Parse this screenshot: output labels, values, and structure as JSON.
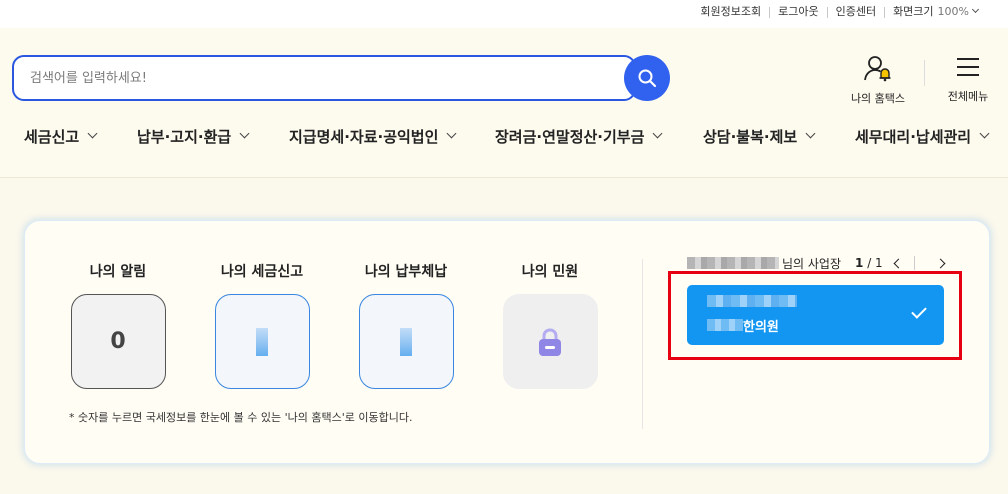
{
  "util_bar": {
    "items": [
      "회원정보조회",
      "로그아웃",
      "인증센터"
    ],
    "zoom_label": "화면크기",
    "zoom_value": "100%"
  },
  "search": {
    "placeholder": "검색어를 입력하세요!",
    "value": "",
    "button_icon": "search-icon"
  },
  "header_actions": {
    "my_hometax": "나의 홈택스",
    "menu_all": "전체메뉴"
  },
  "nav": {
    "items": [
      "세금신고",
      "납부·고지·환급",
      "지급명세·자료·공익법인",
      "장려금·연말정산·기부금",
      "상담·불복·제보",
      "세무대리·납세관리"
    ]
  },
  "dashboard": {
    "tiles": [
      {
        "title": "나의 알림",
        "value": "0"
      },
      {
        "title": "나의 세금신고",
        "value": ""
      },
      {
        "title": "나의 납부체납",
        "value": ""
      },
      {
        "title": "나의 민원",
        "icon": "lock-icon"
      }
    ],
    "footnote": "* 숫자를 누르면 국세정보를 한눈에 볼 수 있는 '나의 홈택스'로 이동합니다."
  },
  "business": {
    "header_suffix": "님의 사업장",
    "page_current": "1",
    "page_total": "/ 1",
    "selected_business_name": "한의원"
  },
  "colors": {
    "accent_blue": "#3161ef",
    "card_blue": "#1296f2",
    "highlight_red": "#e60012",
    "bell_yellow": "#f7c400",
    "lock_purple": "#8f86e6"
  }
}
